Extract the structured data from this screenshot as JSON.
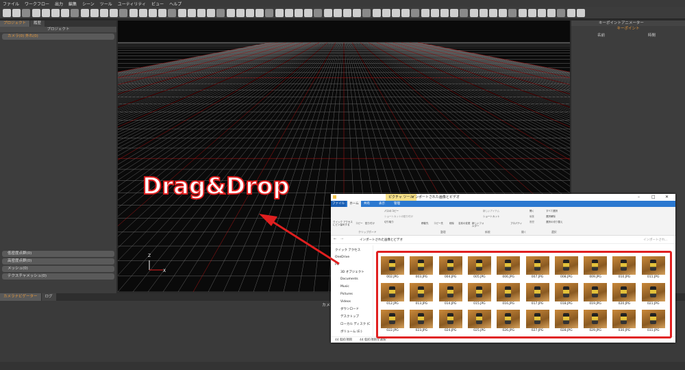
{
  "menubar": [
    "ファイル",
    "ワークフロー",
    "出力",
    "編集",
    "シーン",
    "ツール",
    "ユーティリティ",
    "ビュー",
    "ヘルプ"
  ],
  "left_panel": {
    "tabs": [
      "プロジェクト",
      "履歴"
    ],
    "header": "プロジェクト",
    "top_item": "カメラ(0) 外れ(0)",
    "bottom_items": [
      "低密度点群(0)",
      "高密度点群(0)",
      "メッシュ(0)",
      "テクスチャメッシュ(0)"
    ]
  },
  "right_panel": {
    "title": "キーポイントアニメーター",
    "subtitle": "キーポイント",
    "col_name": "名前",
    "col_time": "時間"
  },
  "bottom_panel": {
    "tabs": [
      "カメラナビゲーター",
      "ログ"
    ],
    "label": "カメラ"
  },
  "viewport": {
    "axis_z": "Z",
    "axis_x": "X"
  },
  "overlay": {
    "drag_text": "Drag&Drop",
    "arrow_color": "#e01f1f"
  },
  "explorer": {
    "title": "インポートされた画像とビデオ",
    "context_tab": "ピクチャ ツール",
    "ribbon_tabs": [
      "ファイル",
      "ホーム",
      "共有",
      "表示",
      "管理"
    ],
    "ribbon_groups": [
      "クリップボード",
      "整理",
      "新規",
      "開く",
      "選択"
    ],
    "ribbon_buttons": [
      "クイック アクセスにピン留めする",
      "コピー",
      "貼り付け",
      "パスのコピー",
      "ショートカットの貼り付け",
      "切り取り",
      "移動先",
      "コピー先",
      "削除",
      "名前の変更",
      "新しいフォルダー",
      "新しいアイテム",
      "ショートカット",
      "プロパティ",
      "開く",
      "編集",
      "履歴",
      "すべて選択",
      "選択解除",
      "選択の切り替え"
    ],
    "address": "インポートされた画像とビデオ",
    "search_placeholder": "インポートされ...",
    "nav": [
      "クイック アクセス",
      "OneDrive",
      "PC",
      "3D オブジェクト",
      "Documents",
      "Music",
      "Pictures",
      "Videos",
      "ダウンロード",
      "デスクトップ",
      "ローカル ディスク (C",
      "ボリューム (E:)"
    ],
    "status_count": "44 個の項目",
    "status_selected": "44 個の項目を選択",
    "files": [
      "002.JPG",
      "003.JPG",
      "004.JPG",
      "005.JPG",
      "006.JPG",
      "007.JPG",
      "008.JPG",
      "009.JPG",
      "010.JPG",
      "011.JPG",
      "012.JPG",
      "013.JPG",
      "014.JPG",
      "015.JPG",
      "016.JPG",
      "017.JPG",
      "018.JPG",
      "019.JPG",
      "020.JPG",
      "021.JPG",
      "022.JPG",
      "023.JPG",
      "024.JPG",
      "025.JPG",
      "026.JPG",
      "027.JPG",
      "028.JPG",
      "029.JPG",
      "030.JPG",
      "031.JPG"
    ]
  }
}
